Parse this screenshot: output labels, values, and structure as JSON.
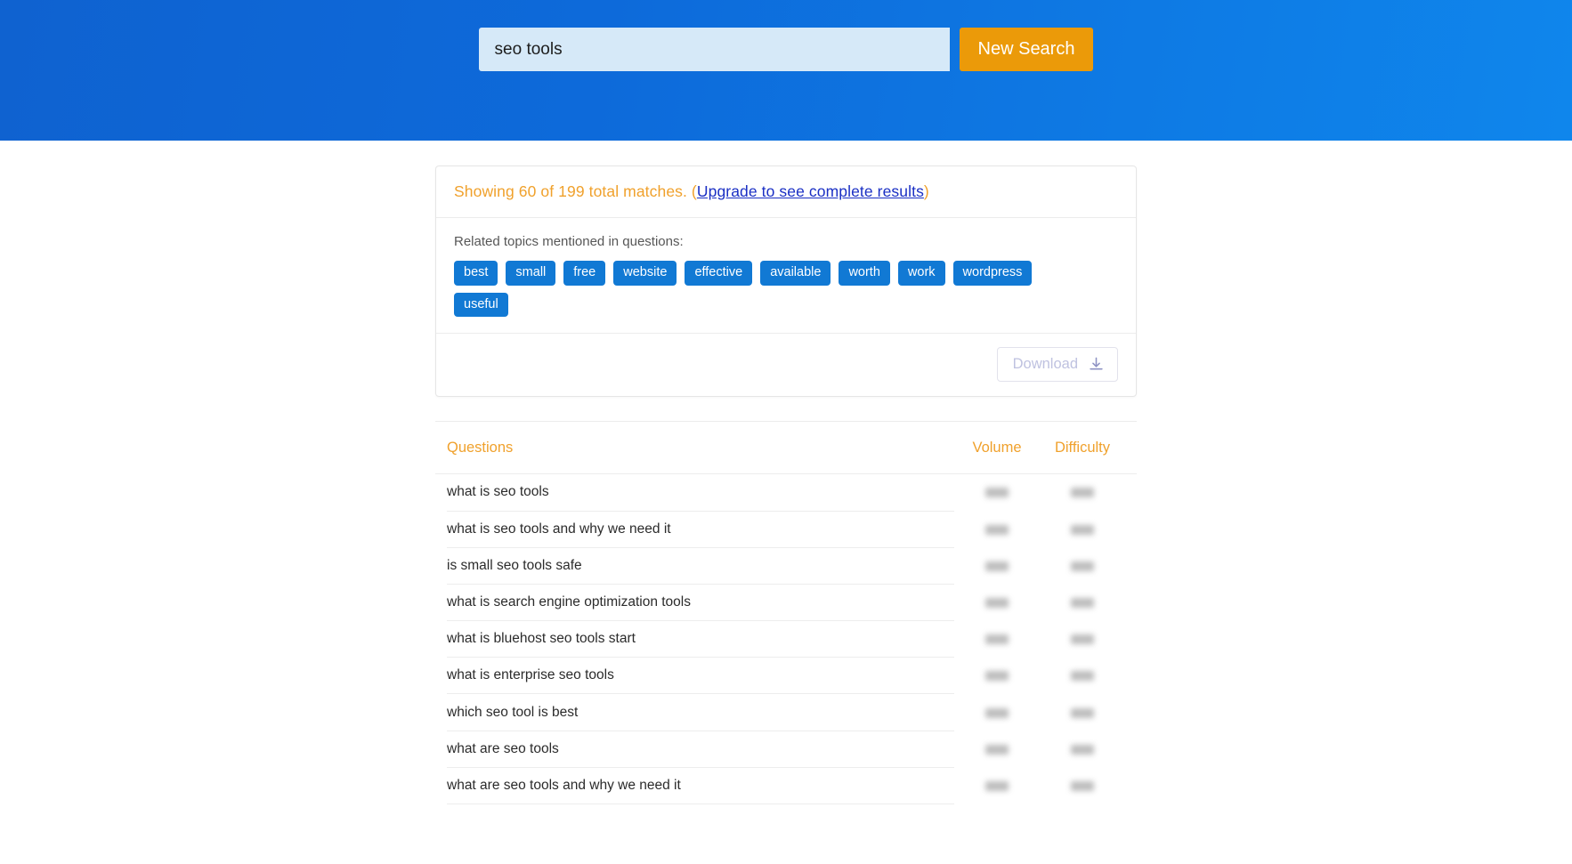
{
  "header": {
    "search_value": "seo tools",
    "search_placeholder": "Enter a keyword",
    "new_search_label": "New Search",
    "accent_color": "#eb9a09",
    "background_color": "#0d6ada"
  },
  "summary": {
    "matches_text": "Showing 60 of 199 total matches. (",
    "upgrade_link": "Upgrade to see complete results",
    "matches_suffix": ")",
    "shown_count": 60,
    "total_count": 199,
    "text_color": "#f0a12c",
    "link_color": "#1a2fc4"
  },
  "related": {
    "label": "Related topics mentioned in questions:",
    "tag_color": "#1179d4",
    "tags": [
      "best",
      "small",
      "free",
      "website",
      "effective",
      "available",
      "worth",
      "work",
      "wordpress",
      "useful"
    ]
  },
  "download": {
    "label": "Download",
    "icon": "download-icon",
    "disabled": true
  },
  "table": {
    "columns": {
      "questions": "Questions",
      "volume": "Volume",
      "difficulty": "Difficulty"
    },
    "rows": [
      {
        "question": "what is seo tools",
        "volume": "",
        "difficulty": ""
      },
      {
        "question": "what is seo tools and why we need it",
        "volume": "",
        "difficulty": ""
      },
      {
        "question": "is small seo tools safe",
        "volume": "",
        "difficulty": ""
      },
      {
        "question": "what is search engine optimization tools",
        "volume": "",
        "difficulty": ""
      },
      {
        "question": "what is bluehost seo tools start",
        "volume": "",
        "difficulty": ""
      },
      {
        "question": "what is enterprise seo tools",
        "volume": "",
        "difficulty": ""
      },
      {
        "question": "which seo tool is best",
        "volume": "",
        "difficulty": ""
      },
      {
        "question": "what are seo tools",
        "volume": "",
        "difficulty": ""
      },
      {
        "question": "what are seo tools and why we need it",
        "volume": "",
        "difficulty": ""
      }
    ]
  }
}
